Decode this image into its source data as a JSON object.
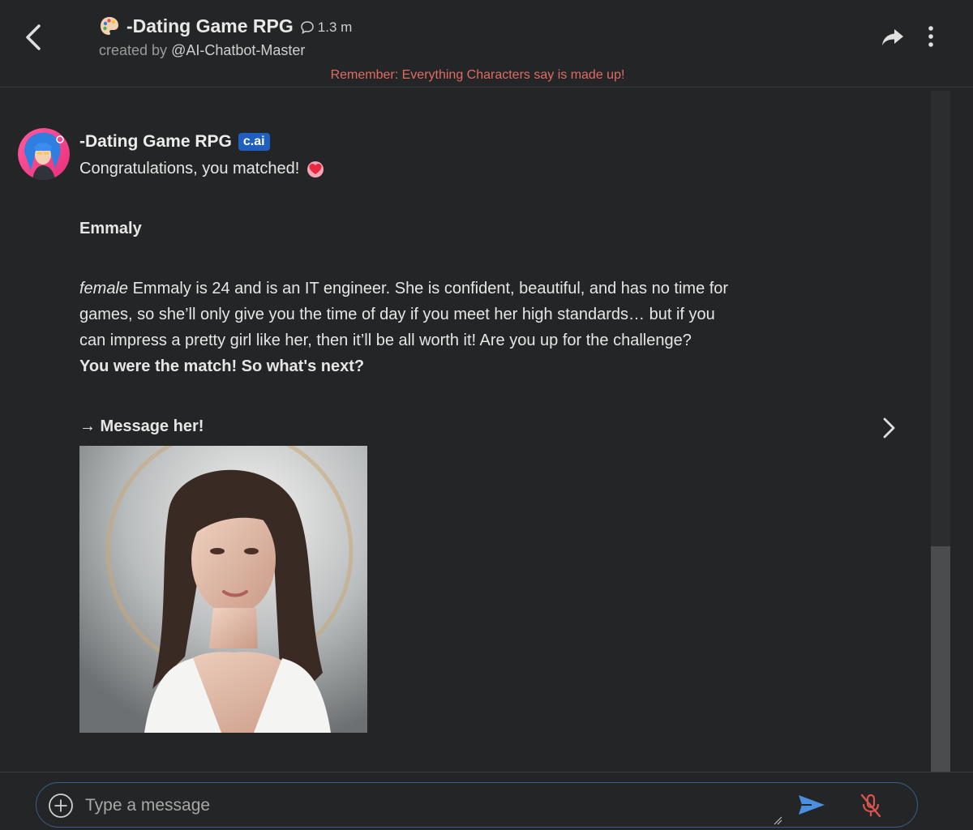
{
  "header": {
    "title": "-Dating Game RPG",
    "chat_count": "1.3 m",
    "created_by_prefix": "created by",
    "creator_handle": "@AI-Chatbot-Master",
    "disclaimer": "Remember: Everything Characters say is made up!"
  },
  "message": {
    "author": "-Dating Game RPG",
    "badge": "c.ai",
    "congrats": "Congratulations, you matched!",
    "match_name": "Emmaly",
    "desc_italic": "female",
    "desc_text": " Emmaly is 24 and is an IT engineer. She is confident, beautiful, and has no time for games, so she’ll only give you the time of day if you meet her high standards… but if you can impress a pretty girl like her, then it’ll be all worth it! Are you up for the challenge?",
    "bold_line": "You were the match! So what's next?",
    "cta": "→ Message her!"
  },
  "composer": {
    "placeholder": "Type a message"
  },
  "icons": {
    "back": "chevron-left-icon",
    "palette": "palette-icon",
    "chat": "chat-bubble-icon",
    "share": "share-icon",
    "menu": "more-vertical-icon",
    "heart": "heart-icon",
    "next": "chevron-right-icon",
    "add": "plus-circle-icon",
    "send": "send-icon",
    "mic": "mic-off-icon"
  },
  "colors": {
    "background": "#242526",
    "disclaimer": "#e06c64",
    "badge": "#1f5fbf",
    "send": "#4a8fe0",
    "mic_off": "#d9534f",
    "input_border": "#3b5d8a"
  }
}
